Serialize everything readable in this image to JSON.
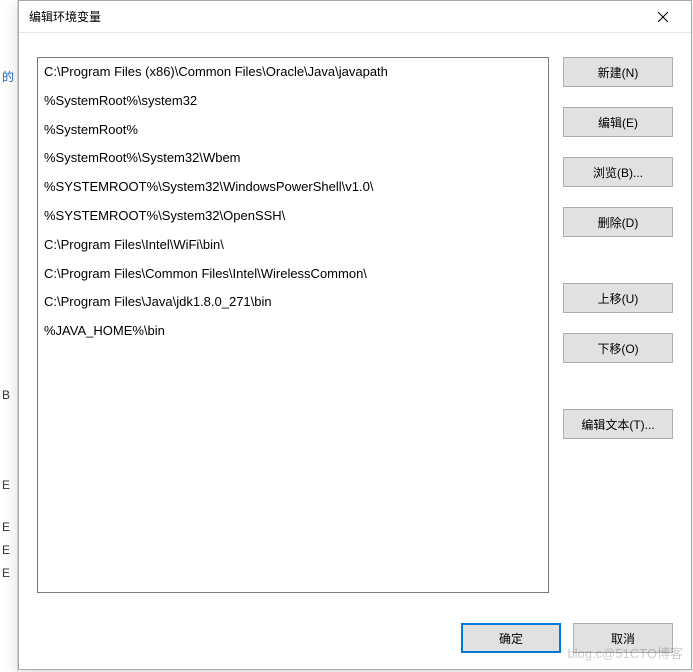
{
  "dialog": {
    "title": "编辑环境变量"
  },
  "list": {
    "items": [
      "C:\\Program Files (x86)\\Common Files\\Oracle\\Java\\javapath",
      "%SystemRoot%\\system32",
      "%SystemRoot%",
      "%SystemRoot%\\System32\\Wbem",
      "%SYSTEMROOT%\\System32\\WindowsPowerShell\\v1.0\\",
      "%SYSTEMROOT%\\System32\\OpenSSH\\",
      "C:\\Program Files\\Intel\\WiFi\\bin\\",
      "C:\\Program Files\\Common Files\\Intel\\WirelessCommon\\",
      "C:\\Program Files\\Java\\jdk1.8.0_271\\bin",
      "%JAVA_HOME%\\bin"
    ]
  },
  "buttons": {
    "new": "新建(N)",
    "edit": "编辑(E)",
    "browse": "浏览(B)...",
    "delete": "删除(D)",
    "moveup": "上移(U)",
    "movedown": "下移(O)",
    "edittext": "编辑文本(T)...",
    "ok": "确定",
    "cancel": "取消"
  },
  "bg": {
    "c1": "的",
    "c2": "B",
    "c3": "E",
    "c4": "E",
    "c5": "E",
    "c6": "E"
  },
  "watermark": "blog.c@51CTO博客"
}
